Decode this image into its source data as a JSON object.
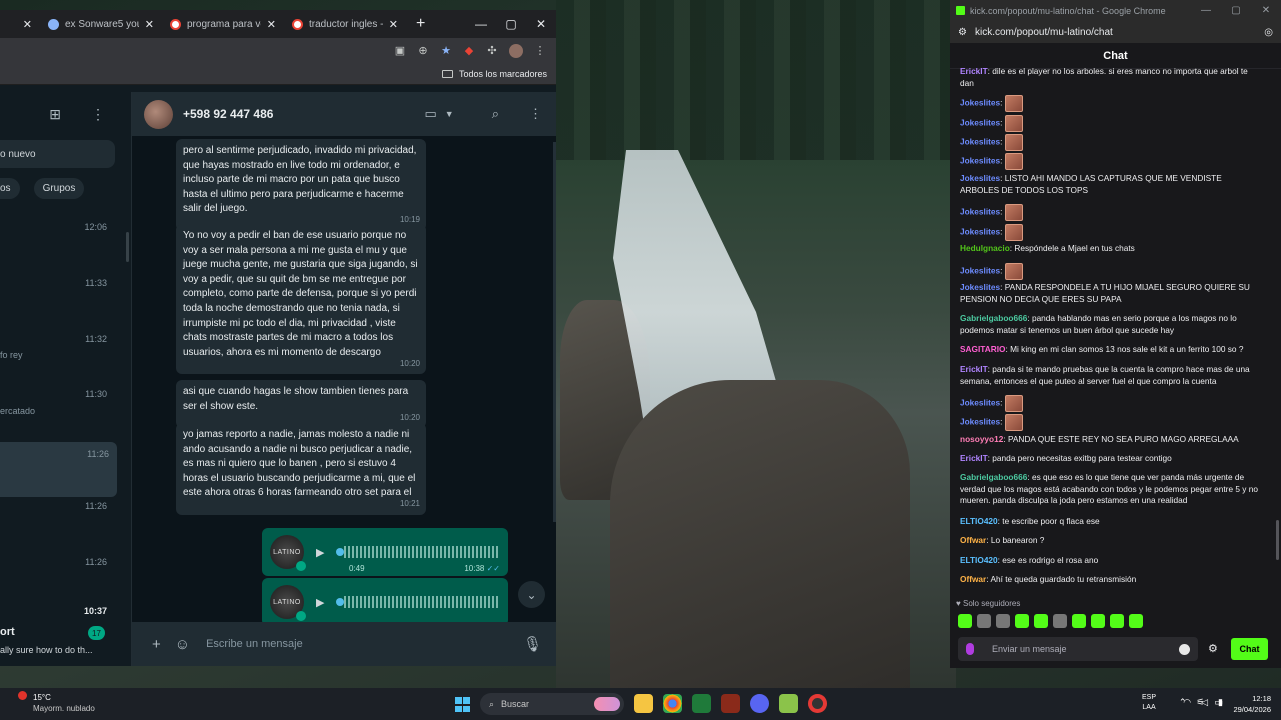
{
  "browser": {
    "tabs": [
      {
        "title": "",
        "icon": "circle-tab-icon"
      },
      {
        "title": "ex Sonware5 youte m",
        "icon": "tab-favicon-icon"
      },
      {
        "title": "programa para ver si",
        "icon": "google-favicon-icon"
      },
      {
        "title": "traductor ingles - Bu",
        "icon": "google-favicon-icon"
      }
    ],
    "bookmarks_label": "Todos los marcadores"
  },
  "whatsapp": {
    "search_text": "o nuevo",
    "chips": [
      "os",
      "Grupos"
    ],
    "chat_times": [
      "12:06",
      "11:33",
      "11:32",
      "11:30",
      "11:26",
      "11:26",
      "11:26",
      "10:37"
    ],
    "chat_snippets": [
      "fo rey",
      "ercatado"
    ],
    "bottom_chat": {
      "name": "ort",
      "snippet": "ally sure how to do th...",
      "badge": "17"
    },
    "contact_name": "+598 92 447 486",
    "messages": [
      {
        "text": "pero al sentirme perjudicado, invadido mi privacidad, que hayas mostrado en live todo mi ordenador, e incluso parte de mi macro por un pata que busco hasta el ultimo pero para perjudicarme e hacerme salir del juego.",
        "time": "10:19"
      },
      {
        "text": "Yo no voy a pedir el ban de ese usuario porque no voy a ser mala persona a mi me gusta el mu y que juege mucha gente, me gustaria que siga jugando, si voy a pedir, que su quit de bm se me entregue por completo, como parte de defensa, porque si yo perdi toda la noche demostrando que no tenia nada, si irrumpiste mi pc todo el dia, mi privacidad , viste chats mostraste partes de mi macro a todos los usuarios, ahora es mi momento de descargo",
        "time": "10:20"
      },
      {
        "text": "asi que cuando hagas le show tambien tienes para ser el show este.",
        "time": "10:20"
      },
      {
        "text": "yo jamas reporto a nadie, jamas molesto a nadie ni ando acusando a nadie ni busco perjudicar a nadie, es mas ni quiero que lo banen , pero si estuvo 4 horas el usuario buscando perjudicarme a mi, que el este ahora otras 6 horas farmeando otro set para el",
        "time": "10:21"
      }
    ],
    "voice_notes": [
      {
        "duration": "0:49",
        "time": "10:38",
        "avatar_text": "LATINO"
      },
      {
        "duration": "",
        "time": "",
        "avatar_text": "LATINO"
      }
    ],
    "compose_placeholder": "Escribe un mensaje"
  },
  "kick": {
    "window_title": "kick.com/popout/mu-latino/chat - Google Chrome",
    "url": "kick.com/popout/mu-latino/chat",
    "chat_title": "Chat",
    "messages": [
      {
        "user": "ErickIT",
        "text": "dile es el player no los arboles. si eres manco no importa que arbol te dan",
        "color": "#b084ff"
      },
      {
        "user": "Jokeslites",
        "text": "",
        "emote": true,
        "color": "#6d8cff"
      },
      {
        "user": "Jokeslites",
        "text": "",
        "emote": true,
        "color": "#6d8cff"
      },
      {
        "user": "Jokeslites",
        "text": "",
        "emote": true,
        "color": "#6d8cff"
      },
      {
        "user": "Jokeslites",
        "text": "",
        "emote": true,
        "color": "#6d8cff"
      },
      {
        "user": "Jokeslites",
        "text": "LISTO AHI MANDO LAS CAPTURAS QUE ME VENDISTE ARBOLES DE TODOS LOS TOPS",
        "color": "#6d8cff"
      },
      {
        "user": "Jokeslites",
        "text": "",
        "emote": true,
        "color": "#6d8cff"
      },
      {
        "user": "Jokeslites",
        "text": "",
        "emote": true,
        "color": "#6d8cff"
      },
      {
        "user": "Hedulgnacio",
        "text": "Respóndele a Mjael en tus chats",
        "color": "#52c41a"
      },
      {
        "user": "Jokeslites",
        "text": "",
        "emote": true,
        "color": "#6d8cff"
      },
      {
        "user": "Jokeslites",
        "text": "PANDA RESPONDELE A TU HIJO MIJAEL SEGURO QUIERE SU PENSION NO DECIA QUE ERES SU PAPA",
        "color": "#6d8cff"
      },
      {
        "user": "Gabrielgaboo666",
        "text": "panda hablando mas en serio porque a los magos no lo podemos matar si tenemos un buen árbol que sucede hay",
        "color": "#4cc9a0"
      },
      {
        "user": "SAGITARIO",
        "text": "Mi king en mi clan somos 13 nos sale el kit a un ferrito 100 so ?",
        "color": "#ff5fd2"
      },
      {
        "user": "ErickIT",
        "text": "panda si te mando pruebas que la cuenta la compro hace mas de una semana, entonces el que puteo al server fuel el que compro la cuenta",
        "color": "#b084ff"
      },
      {
        "user": "Jokeslites",
        "text": "",
        "emote": true,
        "color": "#6d8cff"
      },
      {
        "user": "Jokeslites",
        "text": "",
        "emote": true,
        "color": "#6d8cff"
      },
      {
        "user": "nosoyyo12",
        "text": "PANDA QUE ESTE REY NO SEA PURO MAGO ARREGLAAA",
        "color": "#ff7eb6"
      },
      {
        "user": "ErickIT",
        "text": "panda pero necesitas exitbg para testear contigo",
        "color": "#b084ff"
      },
      {
        "user": "Gabrielgaboo666",
        "text": "es que eso es lo que tiene que ver panda más urgente de verdad que los magos está acabando con todos y le podemos pegar entre 5 y no mueren. panda disculpa la joda pero estamos en una realidad",
        "color": "#4cc9a0"
      },
      {
        "user": "ELTIO420",
        "text": "te escribe poor q flaca ese",
        "color": "#5bc0ff"
      },
      {
        "user": "Offwar",
        "text": "Lo banearon ?",
        "color": "#ffb347"
      },
      {
        "user": "ELTIO420",
        "text": "ese es rodrigo el rosa ano",
        "color": "#5bc0ff"
      },
      {
        "user": "Offwar",
        "text": "Ahí te queda guardado tu retransmisión",
        "color": "#ffb347"
      }
    ],
    "followers_only": "Solo seguidores",
    "input_placeholder": "Enviar un mensaje",
    "send_label": "Chat"
  },
  "taskbar": {
    "temperature": "15°C",
    "weather": "Mayorm. nublado",
    "search_placeholder": "Buscar",
    "lang_1": "ESP",
    "lang_2": "LAA",
    "time": "12:18",
    "date": "29/04/2026"
  }
}
